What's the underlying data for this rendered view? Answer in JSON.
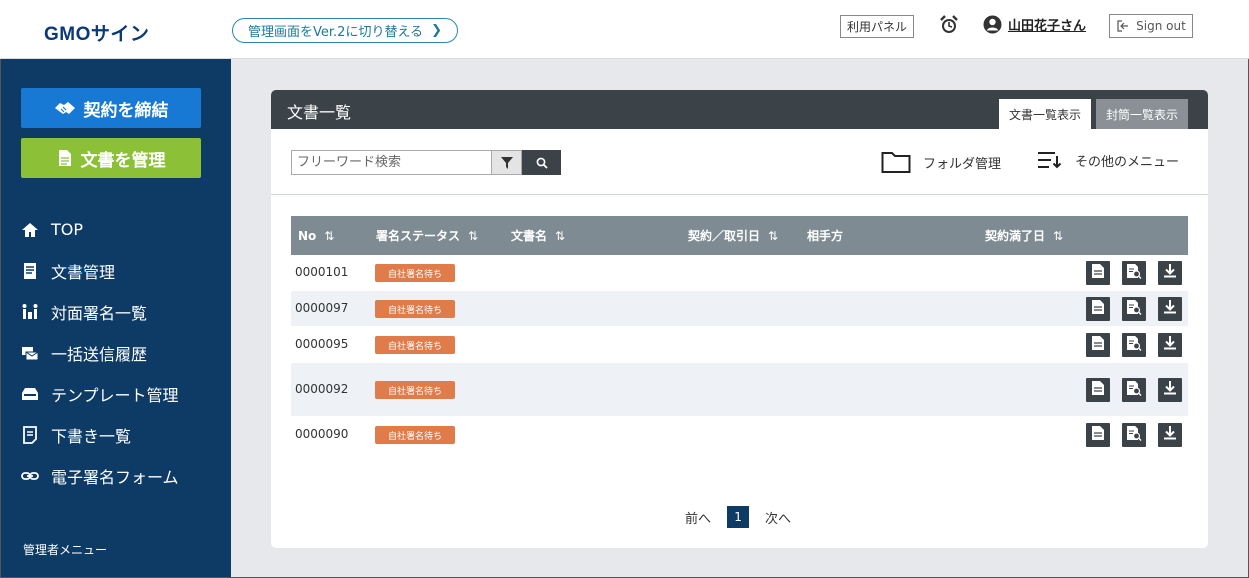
{
  "header": {
    "logo": "GMOサイン",
    "switch_label": "管理画面をVer.2に切り替える",
    "switch_chevron": "❯",
    "panel_label": "利用パネル",
    "alarm_icon": "alarm-clock-icon",
    "user_name": "山田花子さん",
    "signout_label": "Sign out"
  },
  "sidebar": {
    "contract_button": "契約を締結",
    "manage_button": "文書を管理",
    "items": [
      {
        "label": "TOP",
        "icon": "home-icon"
      },
      {
        "label": "文書管理",
        "icon": "document-icon"
      },
      {
        "label": "対面署名一覧",
        "icon": "face-to-face-icon"
      },
      {
        "label": "一括送信履歴",
        "icon": "bulk-send-icon"
      },
      {
        "label": "テンプレート管理",
        "icon": "template-icon"
      },
      {
        "label": "下書き一覧",
        "icon": "draft-icon"
      },
      {
        "label": "電子署名フォーム",
        "icon": "link-icon"
      }
    ],
    "admin_menu": "管理者メニュー",
    "accent": "#0d3b66"
  },
  "main": {
    "title": "文書一覧",
    "tabs": [
      {
        "label": "文書一覧表示",
        "active": true
      },
      {
        "label": "封筒一覧表示",
        "active": false
      }
    ],
    "search": {
      "placeholder": "フリーワード検索"
    },
    "folder_label": "フォルダ管理",
    "other_menu_label": "その他のメニュー",
    "table": {
      "columns": [
        "No",
        "署名ステータス",
        "文書名",
        "契約／取引日",
        "相手方",
        "契約満了日"
      ],
      "sort_glyph": "⇅",
      "rows": [
        {
          "no": "0000101",
          "status": "自社署名待ち"
        },
        {
          "no": "0000097",
          "status": "自社署名待ち"
        },
        {
          "no": "0000095",
          "status": "自社署名待ち"
        },
        {
          "no": "0000092",
          "status": "自社署名待ち"
        },
        {
          "no": "0000090",
          "status": "自社署名待ち"
        }
      ]
    },
    "pager": {
      "prev": "前へ",
      "current": "1",
      "next": "次へ"
    }
  },
  "colors": {
    "contract_button": "#1779d4",
    "manage_button": "#8cc137",
    "status_badge": "#e07b4a",
    "table_header": "#7f8b93",
    "card_header": "#3b4349"
  }
}
